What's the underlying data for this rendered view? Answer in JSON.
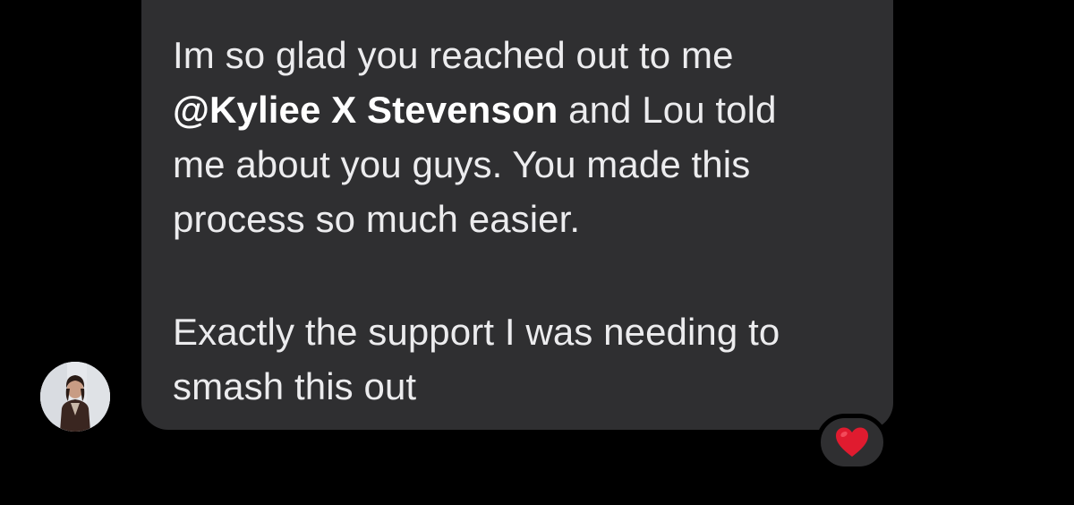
{
  "thread": {
    "message": {
      "paragraph1": {
        "line1": "Im so glad you reached out to me",
        "mention": "@Kyliee X Stevenson",
        "line2_rest": " and Lou told",
        "line3": "me about you guys. You made this",
        "line4": "process so much easier."
      },
      "paragraph2": {
        "line1": "Exactly the support I was needing to",
        "line2": "smash this out"
      }
    },
    "reaction": {
      "icon": "red-heart-icon",
      "color": "#e01b2f"
    },
    "sender": {
      "avatar_icon": "profile-photo-icon"
    }
  },
  "colors": {
    "background": "#000000",
    "bubble": "#2f2f31",
    "text": "#ececee"
  }
}
